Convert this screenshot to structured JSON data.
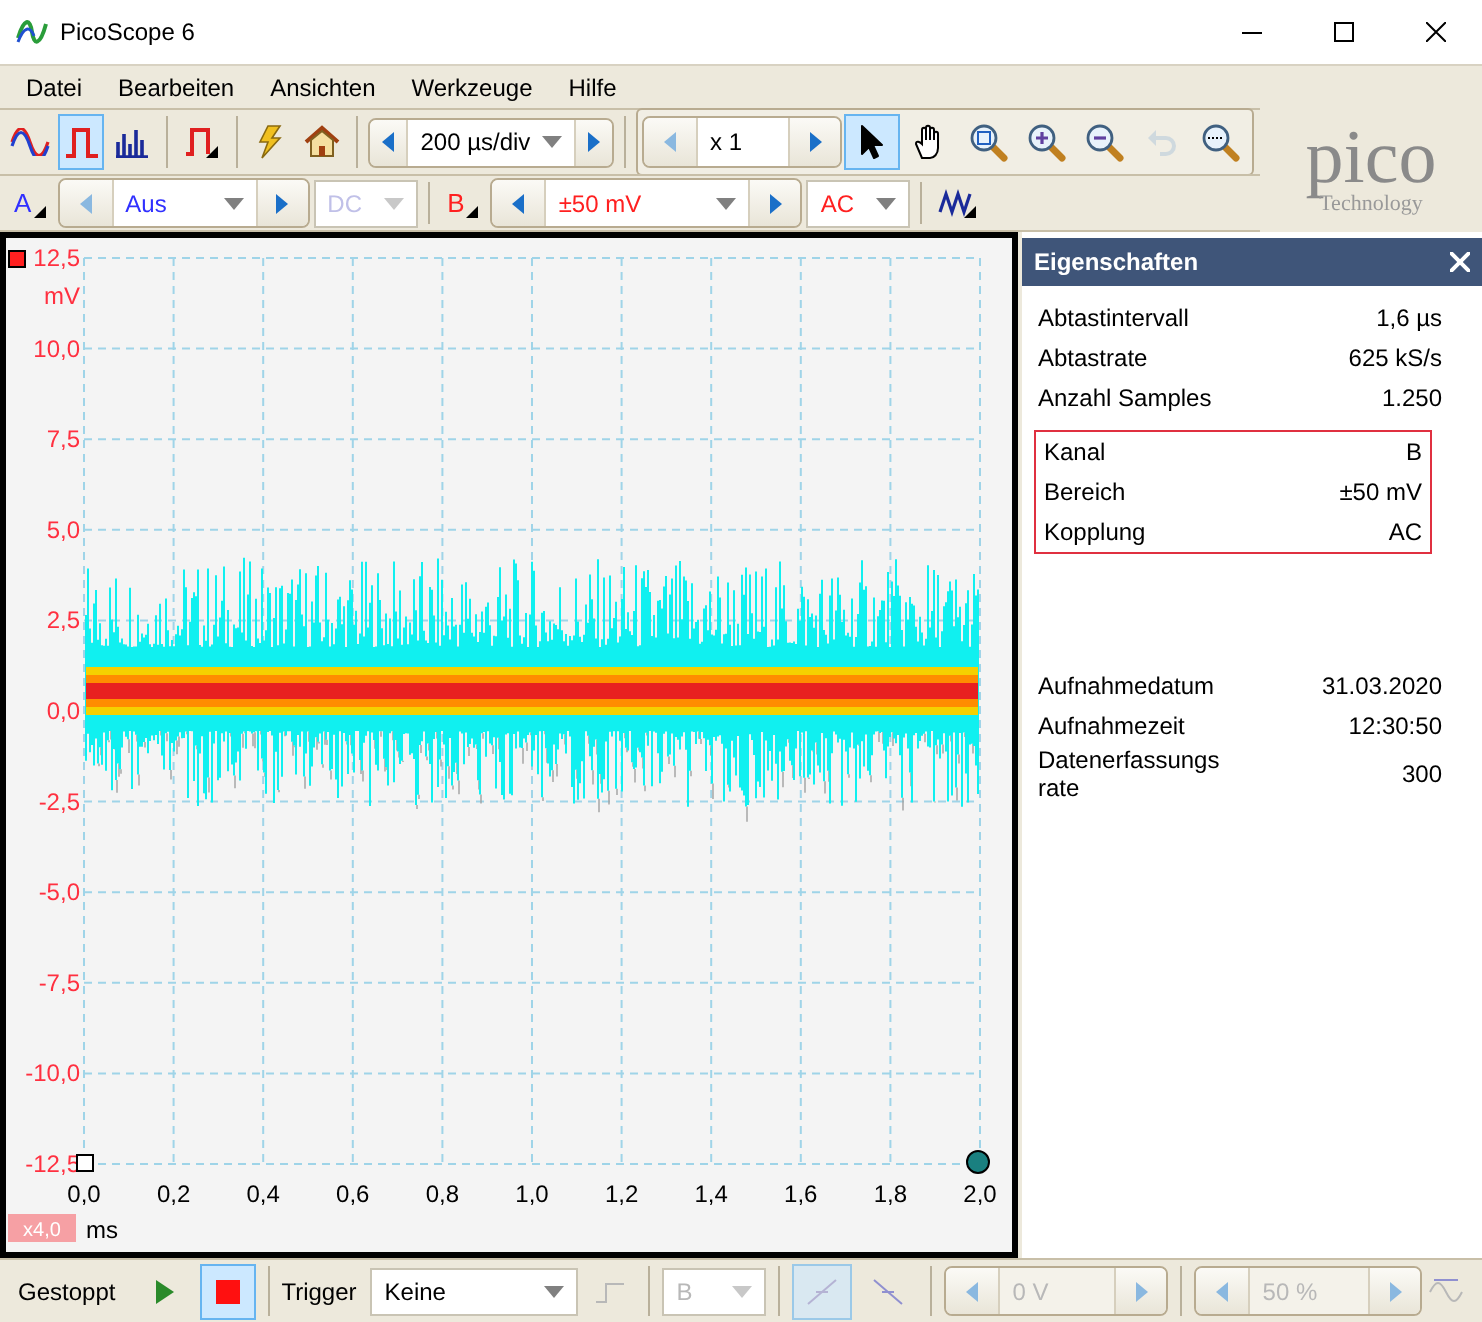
{
  "window": {
    "title": "PicoScope 6"
  },
  "menu": [
    "Datei",
    "Bearbeiten",
    "Ansichten",
    "Werkzeuge",
    "Hilfe"
  ],
  "toolbar": {
    "modes": [
      {
        "kind": "scope",
        "selected": false
      },
      {
        "kind": "persistence",
        "selected": true
      },
      {
        "kind": "spectrum",
        "selected": false
      }
    ],
    "timebase": "200 µs/div",
    "zoom_factor": "x 1",
    "tools": [
      {
        "kind": "pointer",
        "selected": true,
        "disabled": false
      },
      {
        "kind": "hand",
        "selected": false,
        "disabled": false
      },
      {
        "kind": "zoom-fit",
        "selected": false,
        "disabled": false
      },
      {
        "kind": "zoom-in",
        "selected": false,
        "disabled": false
      },
      {
        "kind": "zoom-out",
        "selected": false,
        "disabled": false
      },
      {
        "kind": "undo",
        "selected": false,
        "disabled": true
      },
      {
        "kind": "zoom-100",
        "selected": false,
        "disabled": false
      }
    ]
  },
  "logo": {
    "name": "pico",
    "tagline": "Technology"
  },
  "channels": [
    {
      "label": "A",
      "color": "#3030ff",
      "range": "Aus",
      "coupling": "DC",
      "coupling_disabled": true
    },
    {
      "label": "B",
      "color": "#ff2020",
      "range": "±50 mV",
      "coupling": "AC",
      "coupling_disabled": false
    }
  ],
  "scope": {
    "y_unit": "mV",
    "y_ticks": [
      "12,5",
      "10,0",
      "7,5",
      "5,0",
      "2,5",
      "0,0",
      "-2,5",
      "-5,0",
      "-7,5",
      "-10,0",
      "-12,5"
    ],
    "x_ticks": [
      "0,0",
      "0,2",
      "0,4",
      "0,6",
      "0,8",
      "1,0",
      "1,2",
      "1,4",
      "1,6",
      "1,8",
      "2,0"
    ],
    "x_unit": "ms",
    "zoom_badge": "x4,0"
  },
  "properties": {
    "title": "Eigenschaften",
    "groups": [
      {
        "highlighted": false,
        "rows": [
          {
            "label": "Abtastintervall",
            "value": "1,6 µs"
          },
          {
            "label": "Abtastrate",
            "value": "625 kS/s"
          },
          {
            "label": "Anzahl Samples",
            "value": "1.250"
          }
        ]
      },
      {
        "highlighted": true,
        "rows": [
          {
            "label": "Kanal",
            "value": "B"
          },
          {
            "label": "Bereich",
            "value": "±50 mV"
          },
          {
            "label": "Kopplung",
            "value": "AC"
          }
        ]
      },
      {
        "highlighted": false,
        "rows": [
          {
            "label": "Aufnahmedatum",
            "value": "31.03.2020"
          },
          {
            "label": "Aufnahmezeit",
            "value": "12:30:50"
          },
          {
            "label": "Datenerfassungsrate",
            "value": "300"
          }
        ]
      }
    ]
  },
  "status_bar": {
    "state": "Gestoppt",
    "run_selected": false,
    "stop_selected": true,
    "trigger_label": "Trigger",
    "trigger_mode": "Keine",
    "trigger_channel": "B",
    "threshold": "0 V",
    "pretrigger": "50 %",
    "trigger_controls_disabled": true
  }
}
